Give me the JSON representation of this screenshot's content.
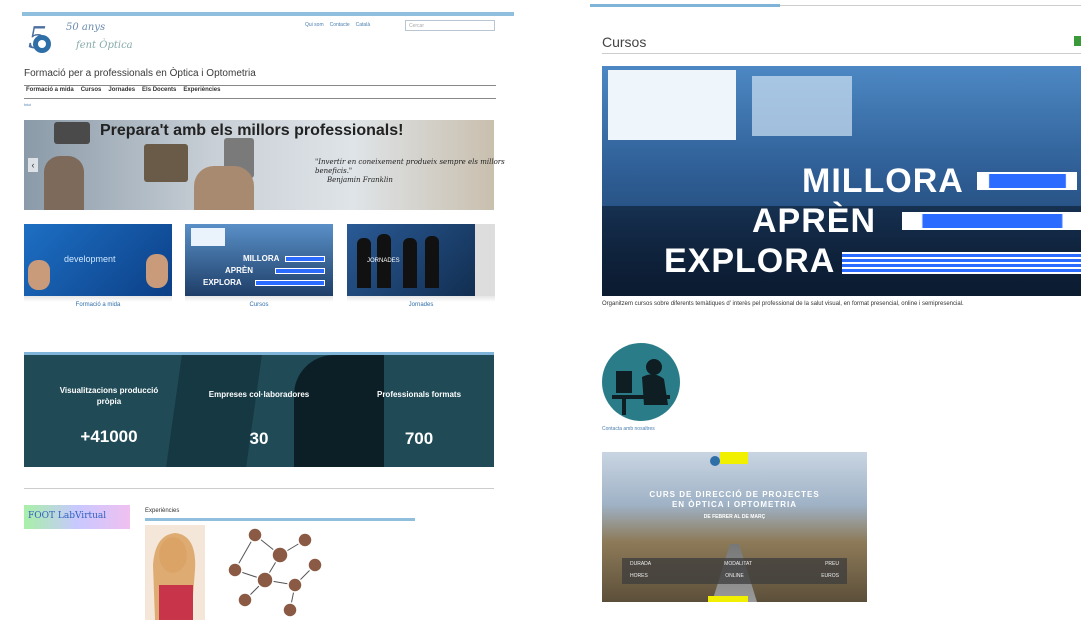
{
  "left": {
    "logo": {
      "line1": "50 anys",
      "line2": "fent Òptica"
    },
    "toplinks": [
      "Qui som",
      "Contacte",
      "Català"
    ],
    "search_placeholder": "Cercar",
    "site_title": "Formació per a professionals en Òptica i Optometria",
    "nav": [
      "Formació a mida",
      "Cursos",
      "Jornades",
      "Els Docents",
      "Experiències"
    ],
    "breadcrumb": "Inici",
    "slider": {
      "title": "Prepara't amb els millors professionals!",
      "quote": "\"Invertir en coneixement produeix sempre els millors beneficis.\"",
      "author": "Benjamin Franklin",
      "arrow": "‹"
    },
    "thumbs": [
      {
        "label": "Formació a mida",
        "image_text": "development"
      },
      {
        "label": "Cursos",
        "image_text": [
          "MILLORA",
          "APRÈN",
          "EXPLORA"
        ]
      },
      {
        "label": "Jornades",
        "image_text": "JORNADES"
      }
    ],
    "stats": [
      {
        "label": "Visualitzacions producció pròpia",
        "value": "+41000"
      },
      {
        "label": "Empreses col·laboradores",
        "value": "30"
      },
      {
        "label": "Professionals formats",
        "value": "700"
      }
    ],
    "lab_badge": "FOOT LabVirtual",
    "experiences_label": "Experiències"
  },
  "right": {
    "section_title": "Cursos",
    "hero_words": [
      "MILLORA",
      "APRÈN",
      "EXPLORA"
    ],
    "description": "Organitzem cursos sobre diferents temàtiques d' interès pel professional de la salut visual, en format presencial, online i semipresencial.",
    "contact": "Contacta amb nosaltres",
    "poster": {
      "title_line1": "CURS DE DIRECCIÓ DE PROJECTES",
      "title_line2": "EN ÒPTICA I OPTOMETRIA",
      "dates": "DE FEBRER AL DE MARÇ",
      "table_row1": [
        "DURADA",
        "MODALITAT",
        "PREU"
      ],
      "table_row2": [
        "HORES",
        "ONLINE",
        "EUROS"
      ]
    }
  },
  "colors": {
    "accent_blue": "#7fb4d8",
    "link_blue": "#2f6fa8",
    "stats_bg": "#1f4a56",
    "hero_blue": "#2b6bff"
  }
}
